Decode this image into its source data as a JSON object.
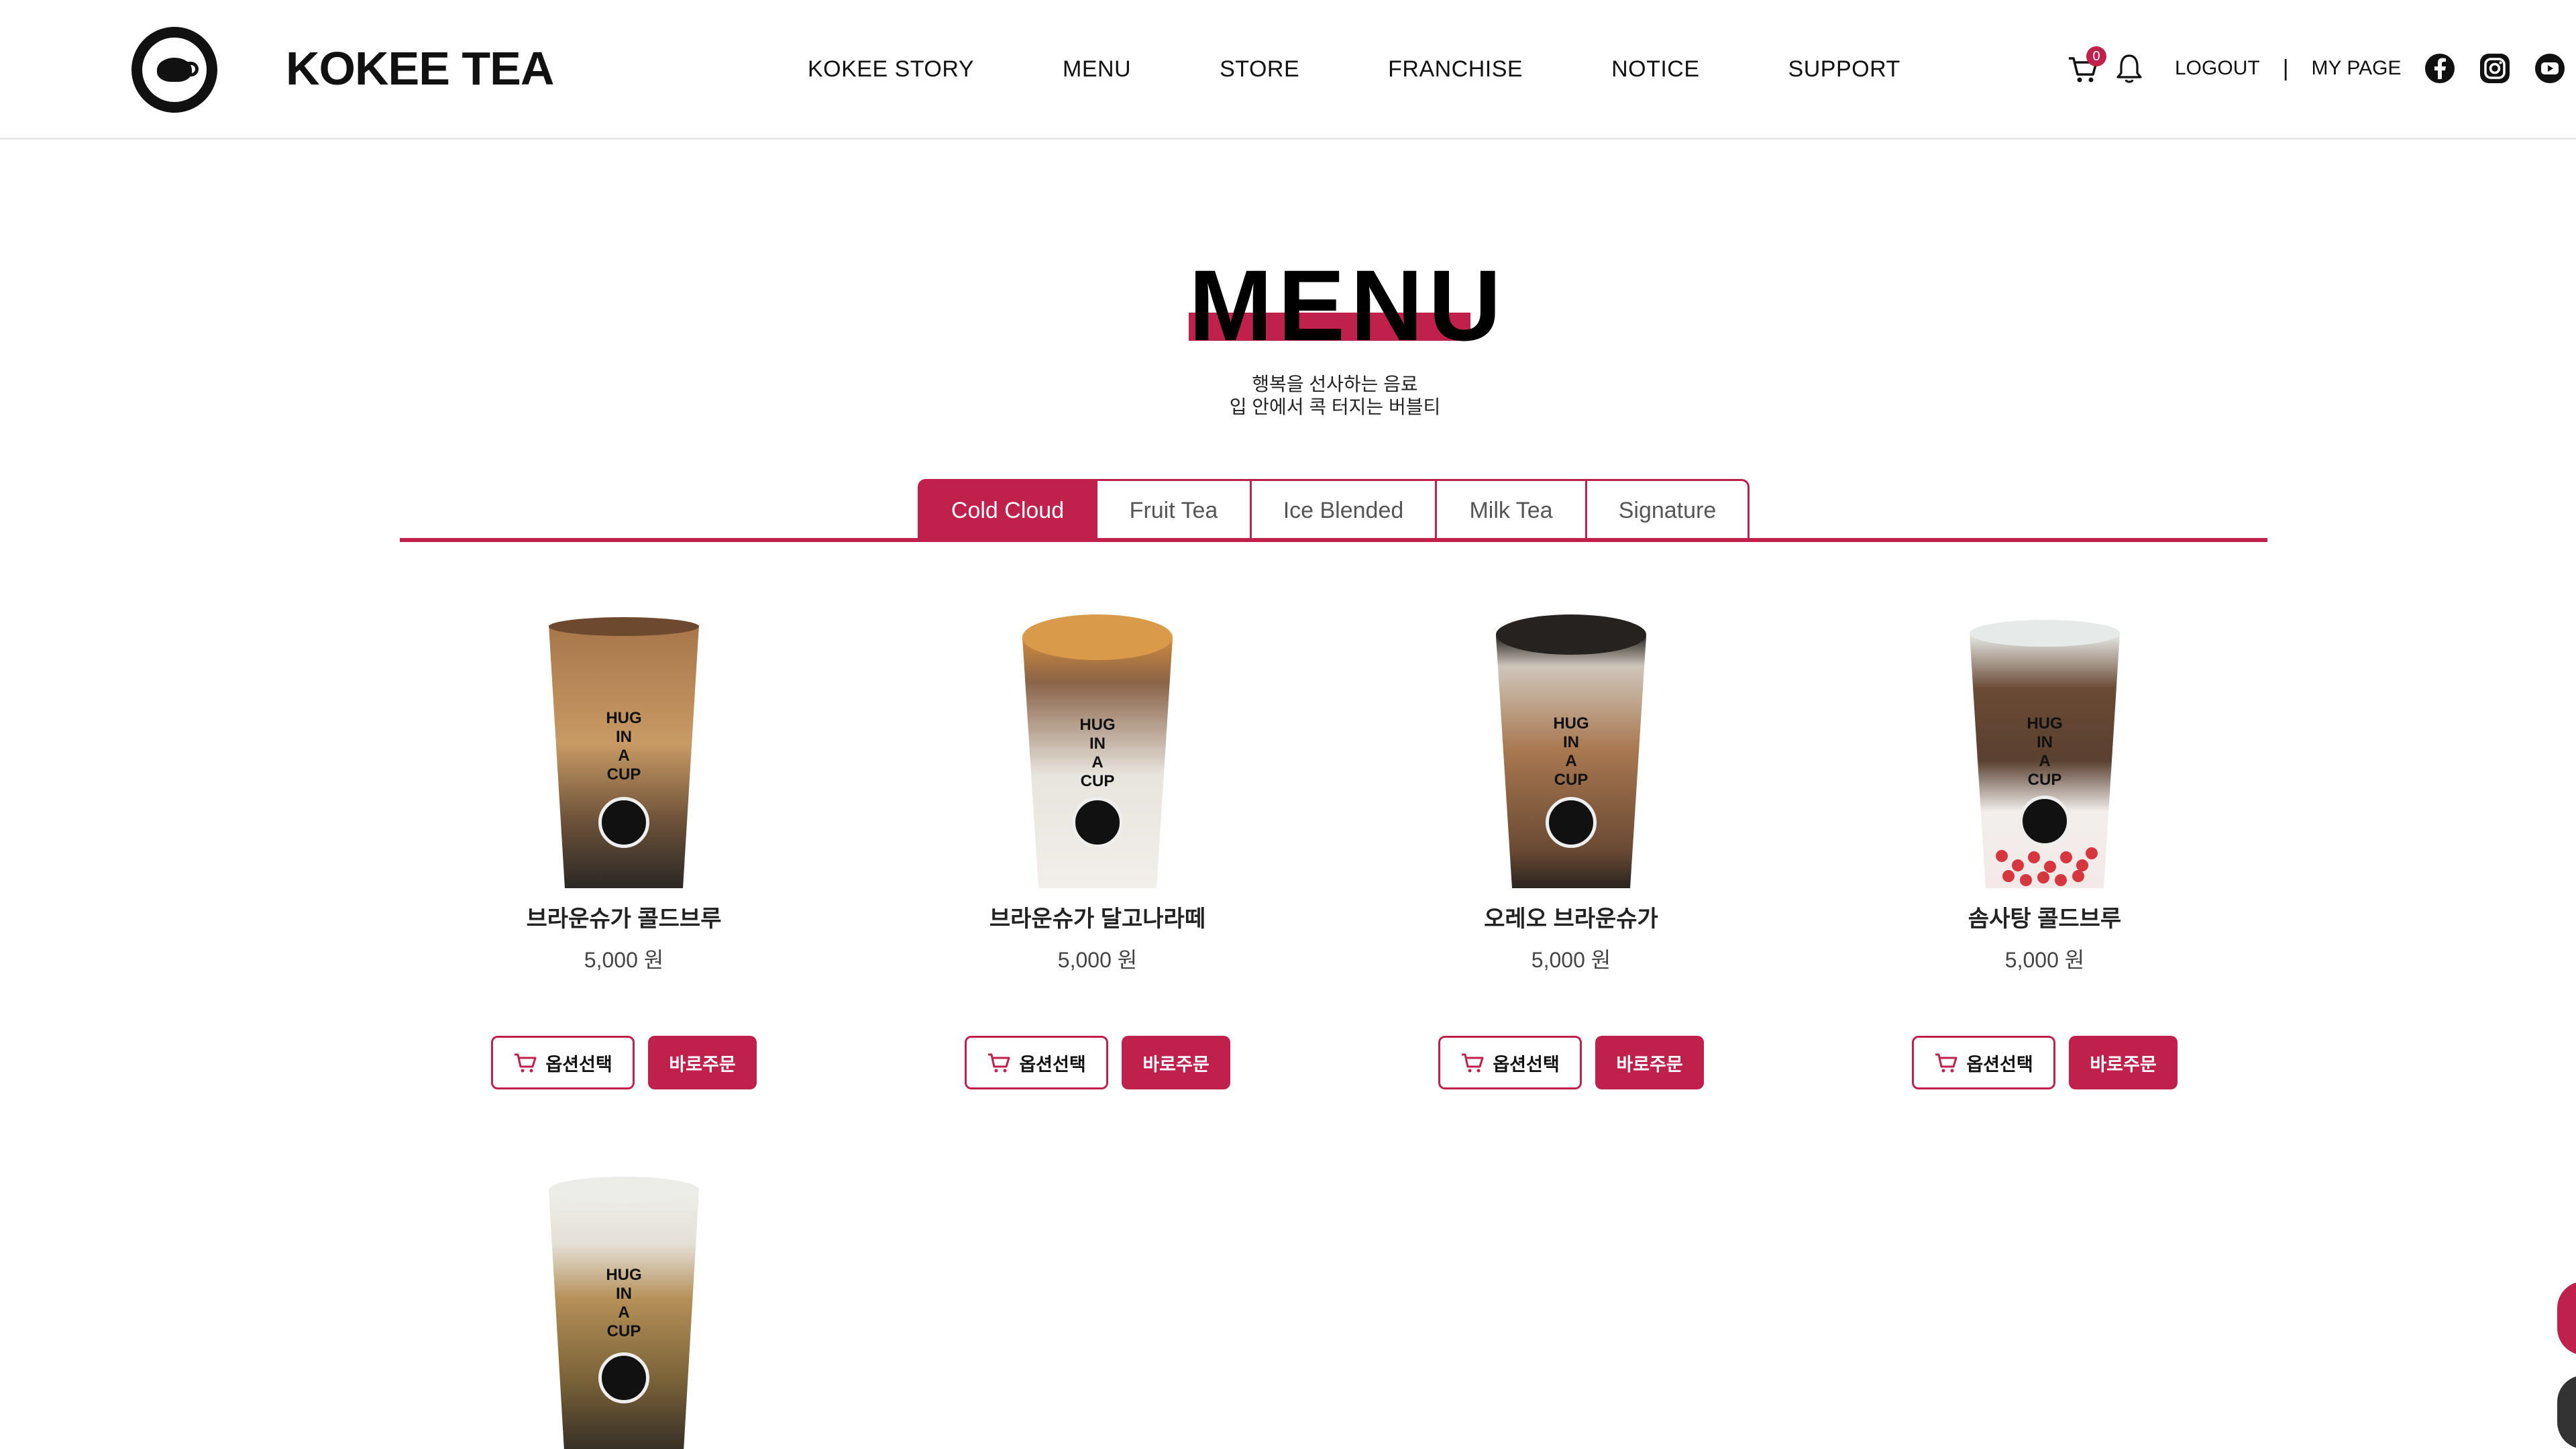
{
  "brand": {
    "name": "KOKEE TEA"
  },
  "nav": [
    {
      "label": "KOKEE STORY"
    },
    {
      "label": "MENU"
    },
    {
      "label": "STORE"
    },
    {
      "label": "FRANCHISE"
    },
    {
      "label": "NOTICE"
    },
    {
      "label": "SUPPORT"
    }
  ],
  "tools": {
    "cart_count": "0",
    "logout": "LOGOUT",
    "separator": "|",
    "mypage": "MY PAGE"
  },
  "page": {
    "title": "MENU",
    "subtitle_line1": "행복을 선사하는 음료",
    "subtitle_line2": "입 안에서 콕 터지는 버블티"
  },
  "tabs": [
    {
      "label": "Cold Cloud",
      "active": true
    },
    {
      "label": "Fruit Tea",
      "active": false
    },
    {
      "label": "Ice Blended",
      "active": false
    },
    {
      "label": "Milk Tea",
      "active": false
    },
    {
      "label": "Signature",
      "active": false
    }
  ],
  "buttons": {
    "option": "옵션선택",
    "buy": "바로주문"
  },
  "cup_text": {
    "line1": "HUG",
    "line2": "IN",
    "line3": "A",
    "line4": "CUP"
  },
  "products": [
    {
      "name": "브라운슈가 콜드브루",
      "price": "5,000 원"
    },
    {
      "name": "브라운슈가 달고나라떼",
      "price": "5,000 원"
    },
    {
      "name": "오레오 브라운슈가",
      "price": "5,000 원"
    },
    {
      "name": "솜사탕 콜드브루",
      "price": "5,000 원"
    }
  ],
  "colors": {
    "accent": "#c0214c",
    "text": "#111111"
  }
}
